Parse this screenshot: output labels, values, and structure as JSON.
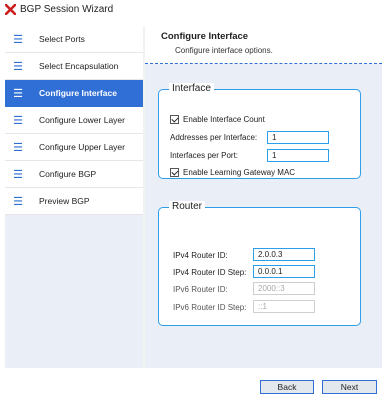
{
  "window": {
    "title": "BGP Session Wizard",
    "logo_icon": "x-logo-icon",
    "accent_color": "#2f6fd6",
    "logo_color": "#cc2020"
  },
  "sidebar": {
    "items": [
      {
        "label": "Select Ports",
        "icon": "menu-lines-icon",
        "active": false
      },
      {
        "label": "Select Encapsulation",
        "icon": "menu-lines-icon",
        "active": false
      },
      {
        "label": "Configure Interface",
        "icon": "menu-lines-icon",
        "active": true
      },
      {
        "label": "Configure Lower Layer",
        "icon": "menu-lines-icon",
        "active": false
      },
      {
        "label": "Configure Upper Layer",
        "icon": "menu-lines-icon",
        "active": false
      },
      {
        "label": "Configure BGP",
        "icon": "menu-lines-icon",
        "active": false
      },
      {
        "label": "Preview BGP",
        "icon": "menu-lines-icon",
        "active": false
      }
    ]
  },
  "pane": {
    "title": "Configure Interface",
    "subtitle": "Configure interface options."
  },
  "interface_group": {
    "legend": "Interface",
    "enable_count": {
      "label": "Enable Interface Count",
      "checked": true
    },
    "addresses_per_interface": {
      "label": "Addresses per Interface:",
      "value": "1"
    },
    "interfaces_per_port": {
      "label": "Interfaces per Port:",
      "value": "1"
    },
    "enable_learning_gateway": {
      "label": "Enable Learning Gateway MAC",
      "checked": true
    }
  },
  "router_group": {
    "legend": "Router",
    "ipv4_router_id": {
      "label": "IPv4 Router ID:",
      "value": "2.0.0.3",
      "enabled": true
    },
    "ipv4_router_id_step": {
      "label": "IPv4 Router ID Step:",
      "value": "0.0.0.1",
      "enabled": true
    },
    "ipv6_router_id": {
      "label": "IPv6 Router ID:",
      "value": "2000::3",
      "enabled": false
    },
    "ipv6_router_id_step": {
      "label": "IPv6 Router ID Step:",
      "value": "::1",
      "enabled": false
    }
  },
  "footer": {
    "back_label": "Back",
    "next_label": "Next"
  }
}
